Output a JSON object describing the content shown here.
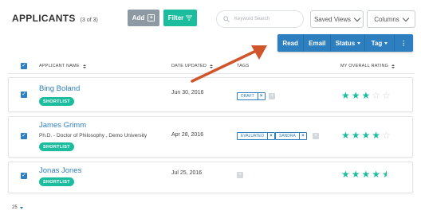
{
  "header": {
    "title": "APPLICANTS",
    "count": "(3 of 3)",
    "add_label": "Add",
    "filter_label": "Filter",
    "search_placeholder": "Keyword Search",
    "saved_views_label": "Saved Views",
    "columns_label": "Columns"
  },
  "actions": {
    "read": "Read",
    "email": "Email",
    "status": "Status",
    "tag": "Tag",
    "more": "⋮"
  },
  "table": {
    "columns": [
      "APPLICANT NAME",
      "DATE UPDATED",
      "TAGS",
      "MY OVERALL RATING"
    ],
    "rows": [
      {
        "name": "Bing Boland",
        "subtitle": "",
        "badge": "SHORTLIST",
        "date": "Jun 30, 2016",
        "tags": [
          "DRAFT"
        ],
        "rating": 3
      },
      {
        "name": "James Grimm",
        "subtitle": "Ph.D. - Doctor of Philosophy , Demo University",
        "badge": "SHORTLIST",
        "date": "Apr 28, 2016",
        "tags": [
          "EVALUATED",
          "SANDRA"
        ],
        "rating": 4
      },
      {
        "name": "Jonas Jones",
        "subtitle": "",
        "badge": "SHORTLIST",
        "date": "Jul 25, 2016",
        "tags": [],
        "rating": 4.5
      }
    ]
  },
  "pagination": {
    "page_size": "25"
  },
  "colors": {
    "accent": "#2e7fbf",
    "teal": "#1bbd9e",
    "arrow": "#d0552a"
  },
  "icons": [
    "plus-icon",
    "filter-icon",
    "search-icon",
    "chevron-down-icon",
    "checkbox-icon",
    "sort-icon",
    "star-icon",
    "close-icon",
    "more-icon",
    "arrow-annotation"
  ]
}
